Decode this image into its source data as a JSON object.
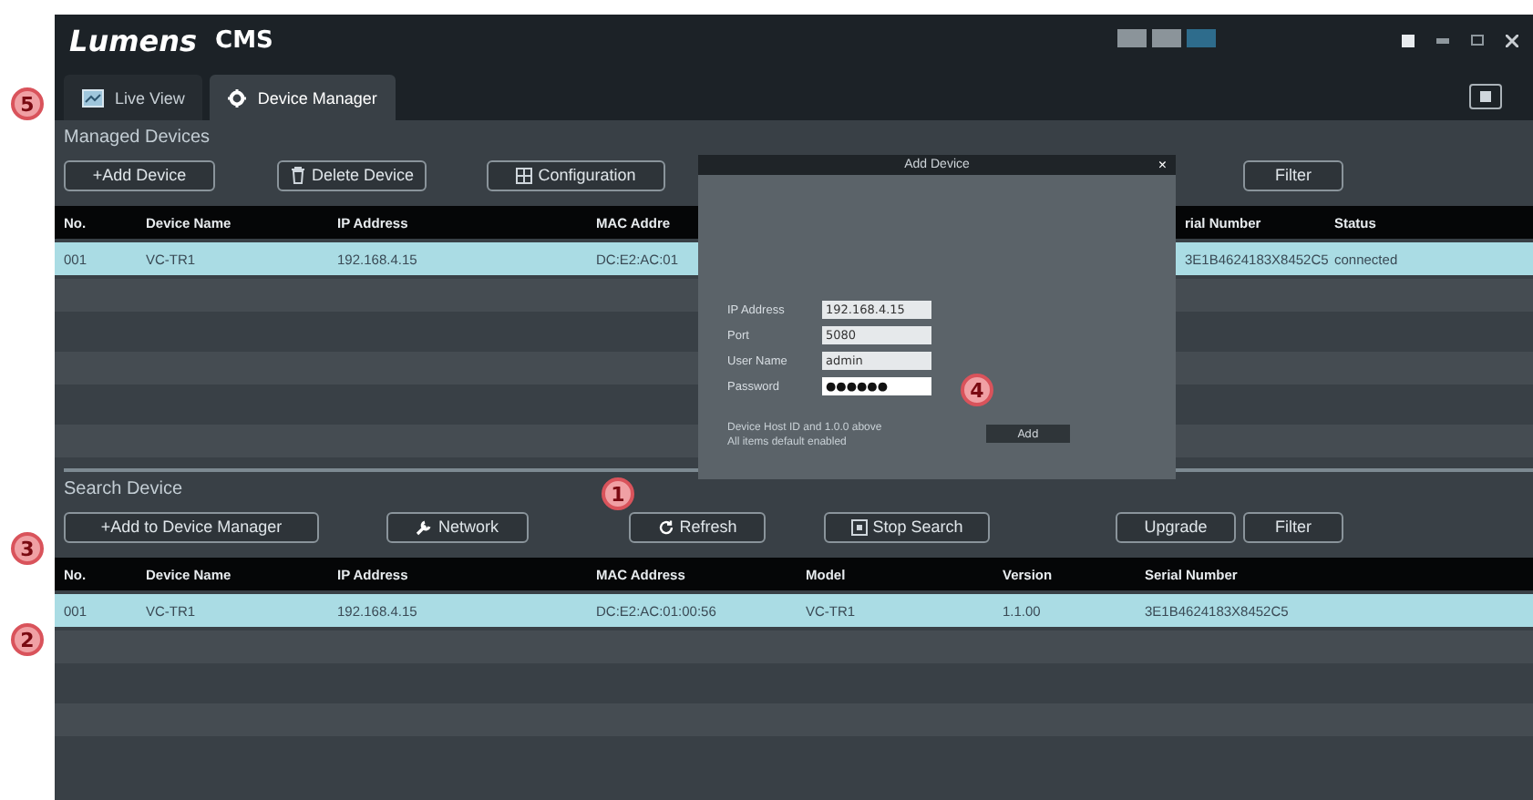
{
  "window": {
    "logo": "Lumens",
    "title": "CMS"
  },
  "tabs": [
    {
      "label": "Live View",
      "selected": false
    },
    {
      "label": "Device Manager",
      "selected": true
    }
  ],
  "managed_devices": {
    "title": "Managed Devices",
    "buttons": [
      "+Add Device",
      "Delete Device",
      "Configuration"
    ],
    "filter": "Filter",
    "table": {
      "columns": [
        "No.",
        "Device Name",
        "IP Address",
        "MAC Addre",
        "rial Number",
        "Status"
      ],
      "rows": [
        {
          "cells": [
            "001",
            "VC-TR1",
            "192.168.4.15",
            "DC:E2:AC:01",
            "3E1B4624183X8452C5",
            "connected"
          ],
          "selected": true
        }
      ]
    }
  },
  "add_device_dialog": {
    "title": "Add Device",
    "close": "×",
    "fields": [
      {
        "label": "IP Address",
        "value": "192.168.4.15",
        "kind": "text"
      },
      {
        "label": "Port",
        "value": "5080",
        "kind": "text"
      },
      {
        "label": "User Name",
        "value": "admin",
        "kind": "text"
      },
      {
        "label": "Password",
        "value": "●●●●●●",
        "kind": "password"
      }
    ],
    "note": [
      "Device Host ID and 1.0.0 above",
      "All items default enabled"
    ],
    "button": "Add"
  },
  "search_device": {
    "title": "Search Device",
    "buttons": [
      "+Add to Device Manager",
      "Network",
      "Refresh",
      "Stop Search",
      "Upgrade",
      "Filter"
    ],
    "table": {
      "columns": [
        "No.",
        "Device Name",
        "IP Address",
        "MAC Address",
        "Model",
        "Version",
        "Serial Number"
      ],
      "rows": [
        {
          "cells": [
            "001",
            "VC-TR1",
            "192.168.4.15",
            "DC:E2:AC:01:00:56",
            "VC-TR1",
            "1.1.00",
            "3E1B4624183X8452C5"
          ],
          "selected": true
        }
      ]
    }
  },
  "annotations": [
    {
      "label": "5"
    },
    {
      "label": "3"
    },
    {
      "label": "2"
    },
    {
      "label": "1"
    },
    {
      "label": "4"
    }
  ]
}
